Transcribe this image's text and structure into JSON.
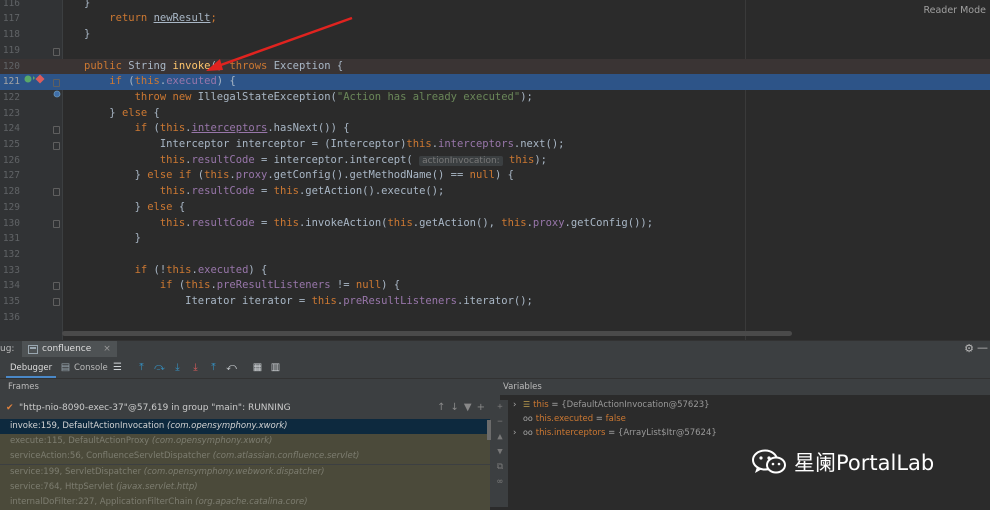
{
  "editor": {
    "reader_mode": "Reader Mode",
    "lines": [
      {
        "n": "116",
        "s": [
          {
            "t": "}",
            "c": ""
          }
        ]
      },
      {
        "n": "117",
        "s": [
          {
            "t": "    ",
            "c": ""
          },
          {
            "t": "return ",
            "c": "kw"
          },
          {
            "t": "newResult",
            "c": "ul"
          },
          {
            "t": ";",
            "c": "kw"
          }
        ]
      },
      {
        "n": "118",
        "s": [
          {
            "t": "}",
            "c": ""
          }
        ]
      },
      {
        "n": "119",
        "s": [
          {
            "t": "",
            "c": ""
          }
        ]
      },
      {
        "n": "120",
        "s": [
          {
            "t": "public ",
            "c": "kw"
          },
          {
            "t": "String ",
            "c": ""
          },
          {
            "t": "invoke",
            "c": "fn"
          },
          {
            "t": "() ",
            "c": ""
          },
          {
            "t": "throws ",
            "c": "kw"
          },
          {
            "t": "Exception {",
            "c": ""
          }
        ]
      },
      {
        "n": "121",
        "s": [
          {
            "t": "    ",
            "c": ""
          },
          {
            "t": "if ",
            "c": "kw"
          },
          {
            "t": "(",
            "c": ""
          },
          {
            "t": "this",
            "c": "kw"
          },
          {
            "t": ".",
            "c": ""
          },
          {
            "t": "executed",
            "c": "fld"
          },
          {
            "t": ") {",
            "c": ""
          }
        ]
      },
      {
        "n": "122",
        "s": [
          {
            "t": "        ",
            "c": ""
          },
          {
            "t": "throw new ",
            "c": "kw"
          },
          {
            "t": "IllegalStateException(",
            "c": ""
          },
          {
            "t": "\"Action has already executed\"",
            "c": "str"
          },
          {
            "t": ");",
            "c": ""
          }
        ]
      },
      {
        "n": "123",
        "s": [
          {
            "t": "    } ",
            "c": ""
          },
          {
            "t": "else ",
            "c": "kw"
          },
          {
            "t": "{",
            "c": ""
          }
        ]
      },
      {
        "n": "124",
        "s": [
          {
            "t": "        ",
            "c": ""
          },
          {
            "t": "if ",
            "c": "kw"
          },
          {
            "t": "(",
            "c": ""
          },
          {
            "t": "this",
            "c": "kw"
          },
          {
            "t": ".",
            "c": ""
          },
          {
            "t": "interceptors",
            "c": "fld ul"
          },
          {
            "t": ".hasNext()) {",
            "c": ""
          }
        ]
      },
      {
        "n": "125",
        "s": [
          {
            "t": "            Interceptor interceptor = (Interceptor)",
            "c": ""
          },
          {
            "t": "this",
            "c": "kw"
          },
          {
            "t": ".",
            "c": ""
          },
          {
            "t": "interceptors",
            "c": "fld"
          },
          {
            "t": ".next();",
            "c": ""
          }
        ]
      },
      {
        "n": "126",
        "s": [
          {
            "t": "            ",
            "c": ""
          },
          {
            "t": "this",
            "c": "kw"
          },
          {
            "t": ".",
            "c": ""
          },
          {
            "t": "resultCode",
            "c": "fld"
          },
          {
            "t": " = interceptor.intercept( ",
            "c": ""
          },
          {
            "t": "actionInvocation:",
            "c": "hint"
          },
          {
            "t": " ",
            "c": ""
          },
          {
            "t": "this",
            "c": "kw"
          },
          {
            "t": ");",
            "c": ""
          }
        ]
      },
      {
        "n": "127",
        "s": [
          {
            "t": "        } ",
            "c": ""
          },
          {
            "t": "else if ",
            "c": "kw"
          },
          {
            "t": "(",
            "c": ""
          },
          {
            "t": "this",
            "c": "kw"
          },
          {
            "t": ".",
            "c": ""
          },
          {
            "t": "proxy",
            "c": "fld"
          },
          {
            "t": ".getConfig().getMethodName() == ",
            "c": ""
          },
          {
            "t": "null",
            "c": "kw"
          },
          {
            "t": ") {",
            "c": ""
          }
        ]
      },
      {
        "n": "128",
        "s": [
          {
            "t": "            ",
            "c": ""
          },
          {
            "t": "this",
            "c": "kw"
          },
          {
            "t": ".",
            "c": ""
          },
          {
            "t": "resultCode",
            "c": "fld"
          },
          {
            "t": " = ",
            "c": ""
          },
          {
            "t": "this",
            "c": "kw"
          },
          {
            "t": ".getAction().execute();",
            "c": ""
          }
        ]
      },
      {
        "n": "129",
        "s": [
          {
            "t": "        } ",
            "c": ""
          },
          {
            "t": "else ",
            "c": "kw"
          },
          {
            "t": "{",
            "c": ""
          }
        ]
      },
      {
        "n": "130",
        "s": [
          {
            "t": "            ",
            "c": ""
          },
          {
            "t": "this",
            "c": "kw"
          },
          {
            "t": ".",
            "c": ""
          },
          {
            "t": "resultCode",
            "c": "fld"
          },
          {
            "t": " = ",
            "c": ""
          },
          {
            "t": "this",
            "c": "kw"
          },
          {
            "t": ".invokeAction(",
            "c": ""
          },
          {
            "t": "this",
            "c": "kw"
          },
          {
            "t": ".getAction(), ",
            "c": ""
          },
          {
            "t": "this",
            "c": "kw"
          },
          {
            "t": ".",
            "c": ""
          },
          {
            "t": "proxy",
            "c": "fld"
          },
          {
            "t": ".getConfig());",
            "c": ""
          }
        ]
      },
      {
        "n": "131",
        "s": [
          {
            "t": "        }",
            "c": ""
          }
        ]
      },
      {
        "n": "132",
        "s": [
          {
            "t": "",
            "c": ""
          }
        ]
      },
      {
        "n": "133",
        "s": [
          {
            "t": "        ",
            "c": ""
          },
          {
            "t": "if ",
            "c": "kw"
          },
          {
            "t": "(!",
            "c": ""
          },
          {
            "t": "this",
            "c": "kw"
          },
          {
            "t": ".",
            "c": ""
          },
          {
            "t": "executed",
            "c": "fld"
          },
          {
            "t": ") {",
            "c": ""
          }
        ]
      },
      {
        "n": "134",
        "s": [
          {
            "t": "            ",
            "c": ""
          },
          {
            "t": "if ",
            "c": "kw"
          },
          {
            "t": "(",
            "c": ""
          },
          {
            "t": "this",
            "c": "kw"
          },
          {
            "t": ".",
            "c": ""
          },
          {
            "t": "preResultListeners",
            "c": "fld"
          },
          {
            "t": " != ",
            "c": ""
          },
          {
            "t": "null",
            "c": "kw"
          },
          {
            "t": ") {",
            "c": ""
          }
        ]
      },
      {
        "n": "135",
        "s": [
          {
            "t": "                Iterator iterator = ",
            "c": ""
          },
          {
            "t": "this",
            "c": "kw"
          },
          {
            "t": ".",
            "c": ""
          },
          {
            "t": "preResultListeners",
            "c": "fld"
          },
          {
            "t": ".iterator();",
            "c": ""
          }
        ]
      },
      {
        "n": "136",
        "s": [
          {
            "t": "",
            "c": ""
          }
        ]
      }
    ]
  },
  "debug": {
    "window_label": "ug:",
    "config_tab": "confluence",
    "tabs": {
      "debugger": "Debugger",
      "console": "Console"
    },
    "frames_label": "Frames",
    "variables_label": "Variables",
    "thread": "\"http-nio-8090-exec-37\"@57,619 in group \"main\": RUNNING",
    "frames": [
      {
        "m": "invoke:159, DefaultActionInvocation",
        "p": "(com.opensymphony.xwork)"
      },
      {
        "m": "execute:115, DefaultActionProxy",
        "p": "(com.opensymphony.xwork)"
      },
      {
        "m": "serviceAction:56, ConfluenceServletDispatcher",
        "p": "(com.atlassian.confluence.servlet)"
      },
      {
        "m": "service:199, ServletDispatcher",
        "p": "(com.opensymphony.webwork.dispatcher)"
      },
      {
        "m": "service:764, HttpServlet",
        "p": "(javax.servlet.http)"
      },
      {
        "m": "internalDoFilter:227, ApplicationFilterChain",
        "p": "(org.apache.catalina.core)"
      }
    ],
    "variables": [
      {
        "name": "this",
        "value": "{DefaultActionInvocation@57623}"
      },
      {
        "name": "this.executed",
        "value": "false"
      },
      {
        "name": "this.interceptors",
        "value": "{ArrayList$Itr@57624}"
      }
    ]
  },
  "watermark": {
    "text": "星阑PortalLab"
  }
}
